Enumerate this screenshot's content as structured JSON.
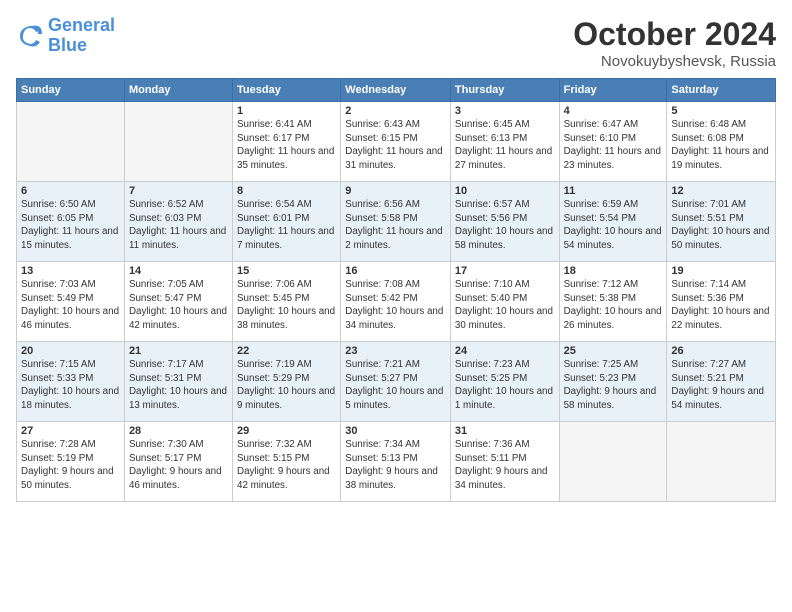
{
  "logo": {
    "line1": "General",
    "line2": "Blue"
  },
  "title": "October 2024",
  "location": "Novokuybyshevsk, Russia",
  "days": [
    "Sunday",
    "Monday",
    "Tuesday",
    "Wednesday",
    "Thursday",
    "Friday",
    "Saturday"
  ],
  "weeks": [
    [
      {
        "num": "",
        "info": ""
      },
      {
        "num": "",
        "info": ""
      },
      {
        "num": "1",
        "info": "Sunrise: 6:41 AM\nSunset: 6:17 PM\nDaylight: 11 hours and 35 minutes."
      },
      {
        "num": "2",
        "info": "Sunrise: 6:43 AM\nSunset: 6:15 PM\nDaylight: 11 hours and 31 minutes."
      },
      {
        "num": "3",
        "info": "Sunrise: 6:45 AM\nSunset: 6:13 PM\nDaylight: 11 hours and 27 minutes."
      },
      {
        "num": "4",
        "info": "Sunrise: 6:47 AM\nSunset: 6:10 PM\nDaylight: 11 hours and 23 minutes."
      },
      {
        "num": "5",
        "info": "Sunrise: 6:48 AM\nSunset: 6:08 PM\nDaylight: 11 hours and 19 minutes."
      }
    ],
    [
      {
        "num": "6",
        "info": "Sunrise: 6:50 AM\nSunset: 6:05 PM\nDaylight: 11 hours and 15 minutes."
      },
      {
        "num": "7",
        "info": "Sunrise: 6:52 AM\nSunset: 6:03 PM\nDaylight: 11 hours and 11 minutes."
      },
      {
        "num": "8",
        "info": "Sunrise: 6:54 AM\nSunset: 6:01 PM\nDaylight: 11 hours and 7 minutes."
      },
      {
        "num": "9",
        "info": "Sunrise: 6:56 AM\nSunset: 5:58 PM\nDaylight: 11 hours and 2 minutes."
      },
      {
        "num": "10",
        "info": "Sunrise: 6:57 AM\nSunset: 5:56 PM\nDaylight: 10 hours and 58 minutes."
      },
      {
        "num": "11",
        "info": "Sunrise: 6:59 AM\nSunset: 5:54 PM\nDaylight: 10 hours and 54 minutes."
      },
      {
        "num": "12",
        "info": "Sunrise: 7:01 AM\nSunset: 5:51 PM\nDaylight: 10 hours and 50 minutes."
      }
    ],
    [
      {
        "num": "13",
        "info": "Sunrise: 7:03 AM\nSunset: 5:49 PM\nDaylight: 10 hours and 46 minutes."
      },
      {
        "num": "14",
        "info": "Sunrise: 7:05 AM\nSunset: 5:47 PM\nDaylight: 10 hours and 42 minutes."
      },
      {
        "num": "15",
        "info": "Sunrise: 7:06 AM\nSunset: 5:45 PM\nDaylight: 10 hours and 38 minutes."
      },
      {
        "num": "16",
        "info": "Sunrise: 7:08 AM\nSunset: 5:42 PM\nDaylight: 10 hours and 34 minutes."
      },
      {
        "num": "17",
        "info": "Sunrise: 7:10 AM\nSunset: 5:40 PM\nDaylight: 10 hours and 30 minutes."
      },
      {
        "num": "18",
        "info": "Sunrise: 7:12 AM\nSunset: 5:38 PM\nDaylight: 10 hours and 26 minutes."
      },
      {
        "num": "19",
        "info": "Sunrise: 7:14 AM\nSunset: 5:36 PM\nDaylight: 10 hours and 22 minutes."
      }
    ],
    [
      {
        "num": "20",
        "info": "Sunrise: 7:15 AM\nSunset: 5:33 PM\nDaylight: 10 hours and 18 minutes."
      },
      {
        "num": "21",
        "info": "Sunrise: 7:17 AM\nSunset: 5:31 PM\nDaylight: 10 hours and 13 minutes."
      },
      {
        "num": "22",
        "info": "Sunrise: 7:19 AM\nSunset: 5:29 PM\nDaylight: 10 hours and 9 minutes."
      },
      {
        "num": "23",
        "info": "Sunrise: 7:21 AM\nSunset: 5:27 PM\nDaylight: 10 hours and 5 minutes."
      },
      {
        "num": "24",
        "info": "Sunrise: 7:23 AM\nSunset: 5:25 PM\nDaylight: 10 hours and 1 minute."
      },
      {
        "num": "25",
        "info": "Sunrise: 7:25 AM\nSunset: 5:23 PM\nDaylight: 9 hours and 58 minutes."
      },
      {
        "num": "26",
        "info": "Sunrise: 7:27 AM\nSunset: 5:21 PM\nDaylight: 9 hours and 54 minutes."
      }
    ],
    [
      {
        "num": "27",
        "info": "Sunrise: 7:28 AM\nSunset: 5:19 PM\nDaylight: 9 hours and 50 minutes."
      },
      {
        "num": "28",
        "info": "Sunrise: 7:30 AM\nSunset: 5:17 PM\nDaylight: 9 hours and 46 minutes."
      },
      {
        "num": "29",
        "info": "Sunrise: 7:32 AM\nSunset: 5:15 PM\nDaylight: 9 hours and 42 minutes."
      },
      {
        "num": "30",
        "info": "Sunrise: 7:34 AM\nSunset: 5:13 PM\nDaylight: 9 hours and 38 minutes."
      },
      {
        "num": "31",
        "info": "Sunrise: 7:36 AM\nSunset: 5:11 PM\nDaylight: 9 hours and 34 minutes."
      },
      {
        "num": "",
        "info": ""
      },
      {
        "num": "",
        "info": ""
      }
    ]
  ]
}
